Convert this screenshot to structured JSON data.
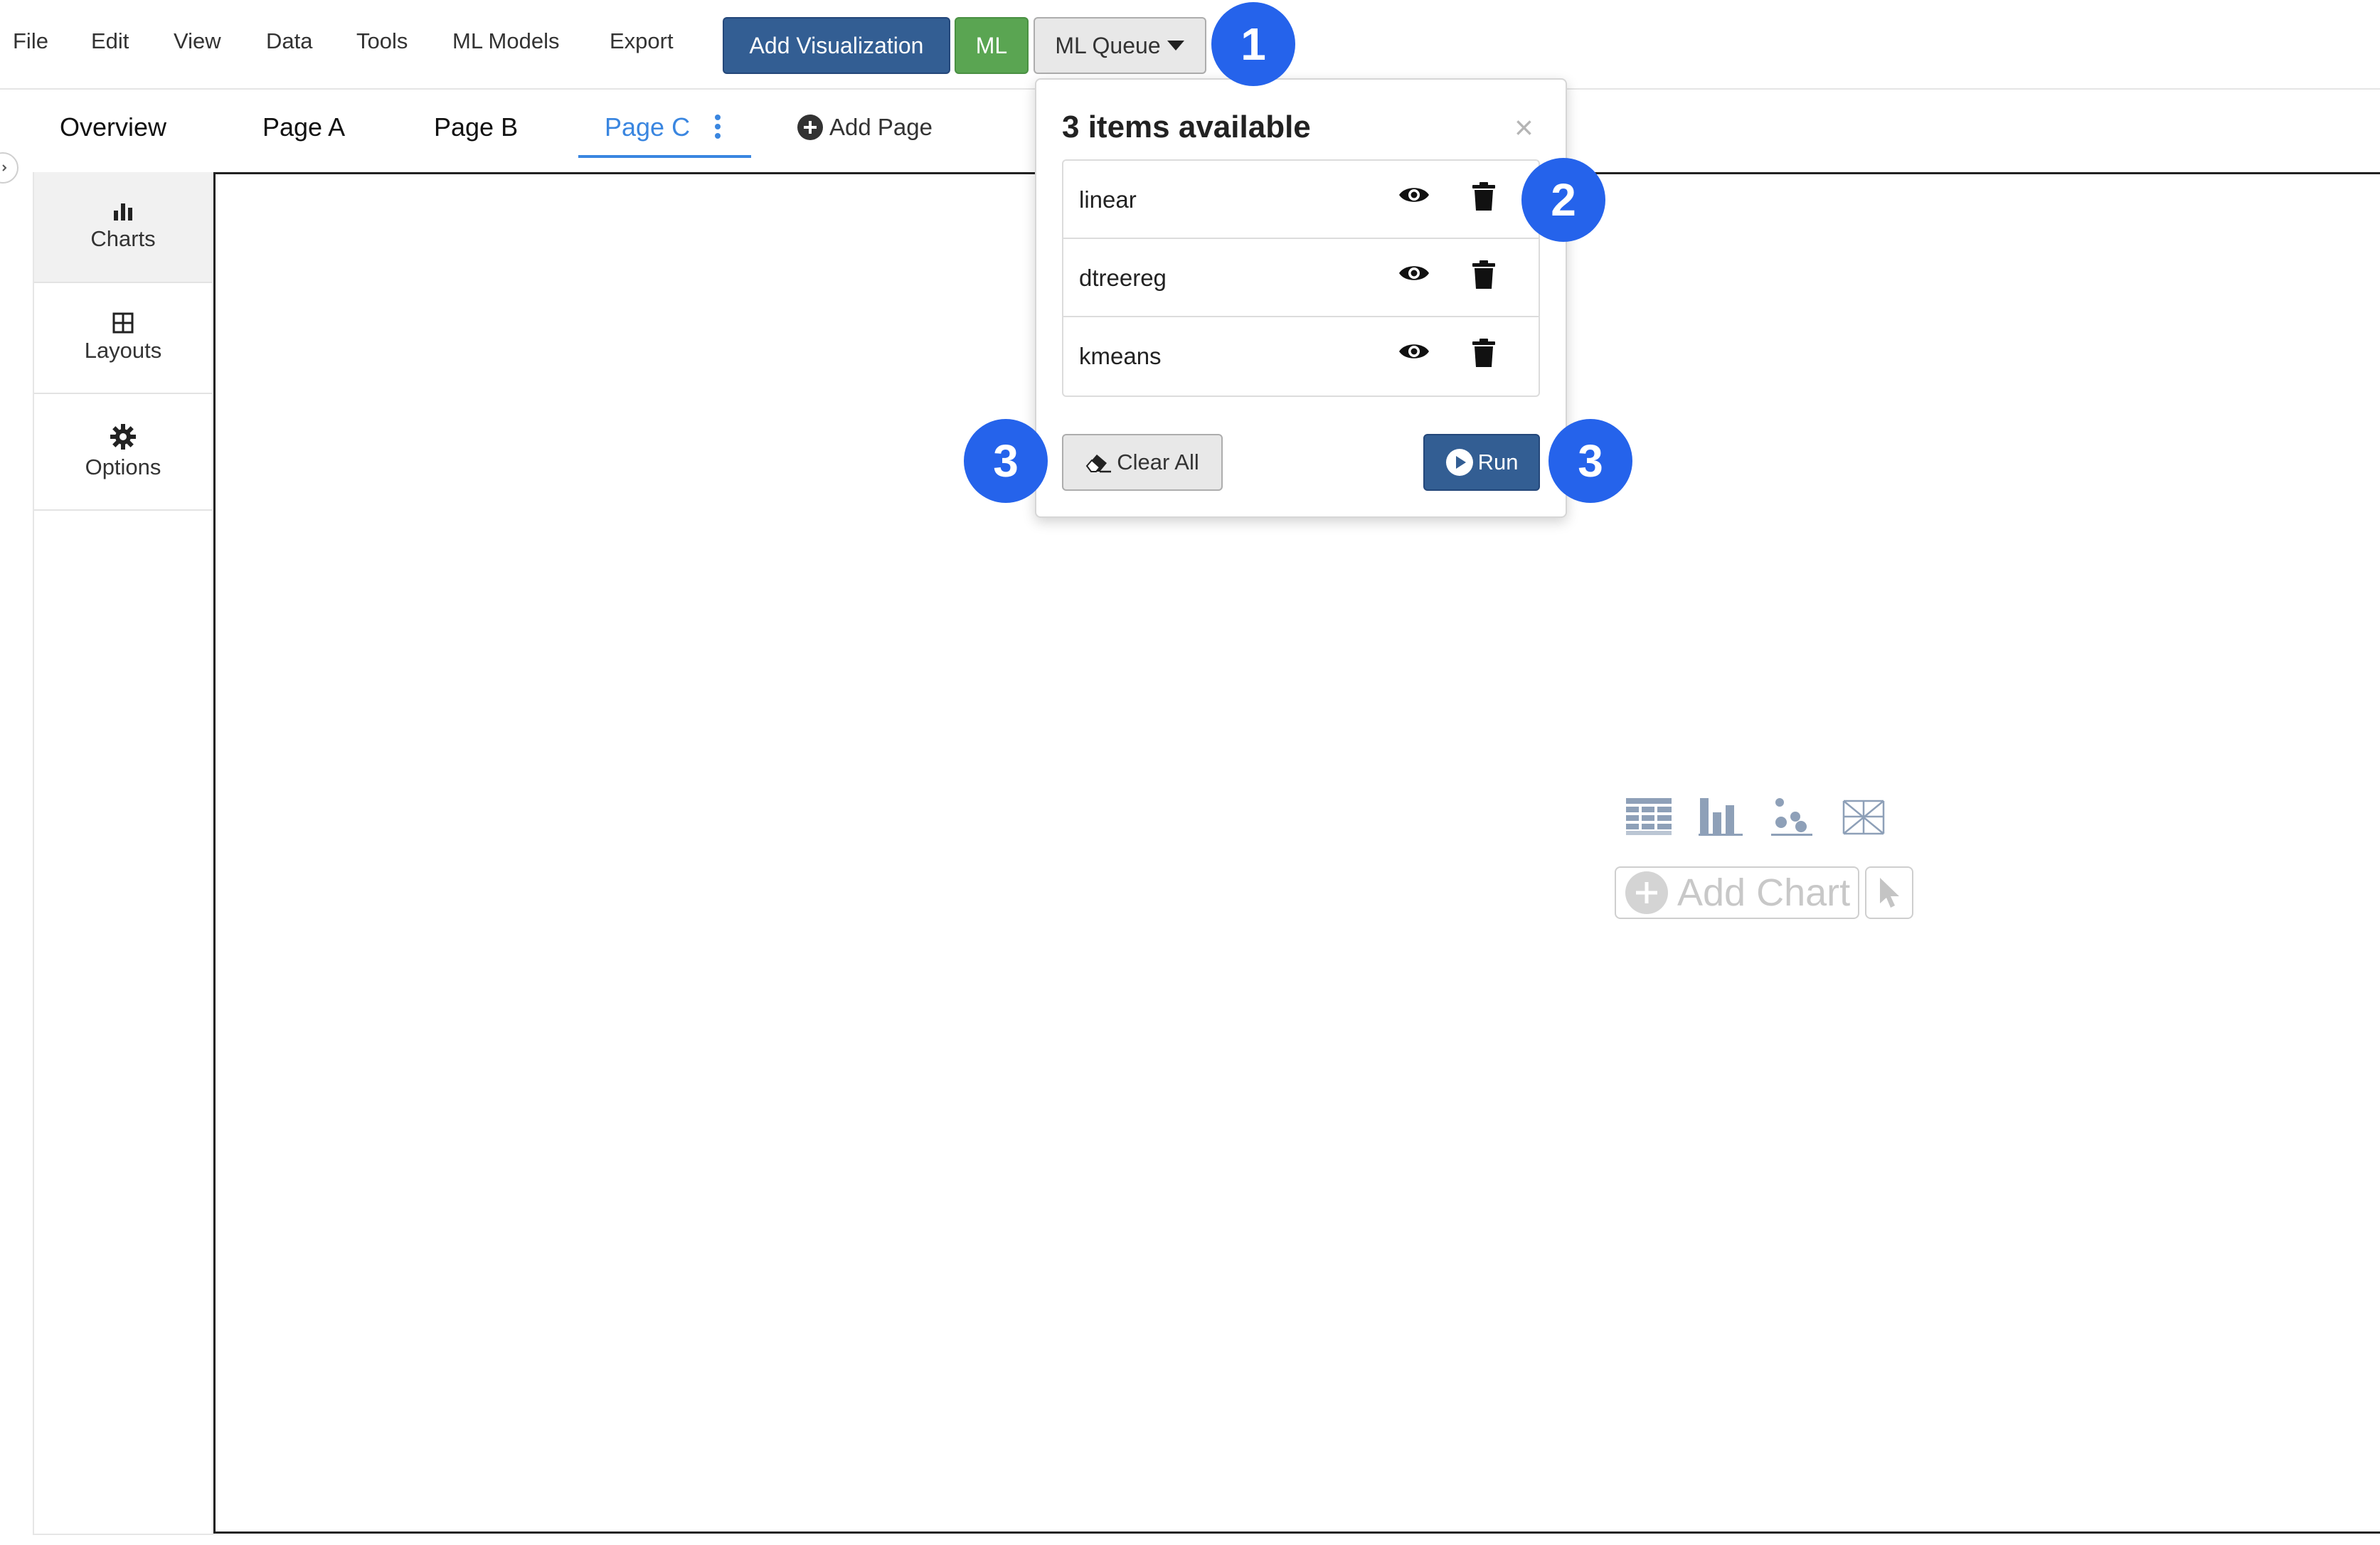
{
  "menubar": {
    "items": [
      "File",
      "Edit",
      "View",
      "Data",
      "Tools",
      "ML Models",
      "Export"
    ],
    "add_visualization_label": "Add Visualization",
    "ml_label": "ML",
    "ml_queue_label": "ML Queue"
  },
  "tabs": {
    "items": [
      {
        "label": "Overview"
      },
      {
        "label": "Page A"
      },
      {
        "label": "Page B"
      },
      {
        "label": "Page C",
        "active": true
      }
    ],
    "add_page_label": "Add Page"
  },
  "sidebar": {
    "items": [
      {
        "label": "Charts",
        "icon": "bar-chart-icon",
        "active": true
      },
      {
        "label": "Layouts",
        "icon": "grid-icon"
      },
      {
        "label": "Options",
        "icon": "gear-icon"
      }
    ]
  },
  "ml_queue_popover": {
    "title": "3 items available",
    "close_symbol": "×",
    "items": [
      {
        "name": "linear"
      },
      {
        "name": "dtreereg"
      },
      {
        "name": "kmeans"
      }
    ],
    "clear_all_label": "Clear All",
    "run_label": "Run"
  },
  "badges": {
    "b1": "1",
    "b2": "2",
    "b3_left": "3",
    "b3_right": "3"
  },
  "canvas": {
    "add_chart_label": "Add Chart"
  },
  "colors": {
    "primary": "#335e93",
    "success": "#5aa552",
    "tab_active": "#3a86e0",
    "badge": "#2563eb"
  }
}
